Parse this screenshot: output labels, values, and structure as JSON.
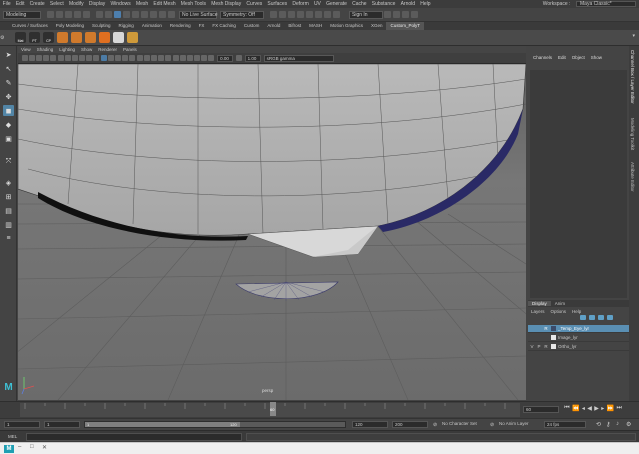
{
  "menubar": {
    "items": [
      "File",
      "Edit",
      "Create",
      "Select",
      "Modify",
      "Display",
      "Windows",
      "Mesh",
      "Edit Mesh",
      "Mesh Tools",
      "Mesh Display",
      "Curves",
      "Surfaces",
      "Deform",
      "UV",
      "Generate",
      "Cache",
      "Substance",
      "Arnold",
      "Help"
    ],
    "workspace_label": "Workspace :",
    "workspace_value": "Maya Classic*"
  },
  "statusline": {
    "mode": "Modeling",
    "live_surface": "No Live Surface",
    "symmetry": "Symmetry: Off",
    "sign_in": "Sign In"
  },
  "shelf_tabs": {
    "items": [
      "Curves / Surfaces",
      "Poly Modeling",
      "Sculpting",
      "Rigging",
      "Animation",
      "Rendering",
      "FX",
      "FX Caching",
      "Custom",
      "Arnold",
      "Bifrost",
      "MASH",
      "Motion Graphics",
      "XGen",
      "Custom_PolyT"
    ],
    "active": "Custom_PolyT"
  },
  "shelf_icons": [
    "Mat",
    "PT",
    "CP",
    "",
    "",
    "",
    "",
    "",
    ""
  ],
  "panel_menu": [
    "View",
    "Shading",
    "Lighting",
    "Show",
    "Renderer",
    "Panels"
  ],
  "panel_toolbar": {
    "near_value": "0.00",
    "far_value": "1.00",
    "color_space": "sRGB gamma"
  },
  "viewport": {
    "camera": "persp"
  },
  "channel_box": {
    "menu": [
      "Channels",
      "Edit",
      "Object",
      "Show"
    ]
  },
  "layer_editor": {
    "tabs": [
      "Display",
      "Anim"
    ],
    "active_tab": "Display",
    "menu": [
      "Layers",
      "Options",
      "Help"
    ],
    "layers": [
      {
        "v": "",
        "p": "",
        "r": "R",
        "name": "_Temp_Eye_lyr",
        "color": "#3a4b6a",
        "selected": true
      },
      {
        "v": "",
        "p": "",
        "r": "",
        "name": "Image_lyr",
        "color": "#e8e8e8",
        "selected": false
      },
      {
        "v": "V",
        "p": "P",
        "r": "R",
        "name": "Ortho_lyr",
        "color": "#e8e8e8",
        "selected": false
      }
    ]
  },
  "side_tabs": [
    "Channel Box / Layer Editor",
    "Modeling Toolkit",
    "Attribute Editor"
  ],
  "time_slider": {
    "current_frame": "60",
    "current_field": "60"
  },
  "range_bar": {
    "start": "1",
    "anim_start": "1",
    "playback_start": "1",
    "playback_end": "120",
    "range_end": "120",
    "anim_end": "200",
    "character_set": "No Character Set",
    "anim_layer": "No Anim Layer",
    "fps": "24 fps"
  },
  "command_line": {
    "label": "MEL"
  },
  "accent": "#5285a6"
}
